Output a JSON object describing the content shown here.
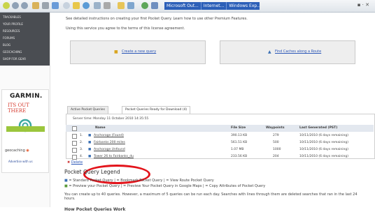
{
  "browser": {
    "taskbar_items": [
      "Microsoft Out...",
      "Internet...",
      "Windows Exp..."
    ],
    "window_controls": "▪ · ✕"
  },
  "sidebar": {
    "nav_items": [
      "TRACKABLES",
      "YOUR PROFILE",
      "RESOURCES",
      "FORUMS",
      "BLOG",
      "GEOCACHING",
      "SHOP FOR GEAR"
    ],
    "ad": {
      "logo": "GARMIN.",
      "tagline": "ITS OUT THERE",
      "geocaching": "geocaching",
      "link": "Advertise with us"
    }
  },
  "main": {
    "top_line": "See detailed instructions on creating your first Pocket Query. Learn how to use other Premium Features.",
    "license_line": "Using this service you agree to the terms of this license agreement.",
    "create_query": "Create a new query",
    "find_caches": "Find Caches along a Route",
    "tabs": {
      "active": "Active Pocket Queries",
      "ready": "Pocket Queries Ready for Download (4)"
    },
    "server_time": "Server time: Monday 11 October 2010 14:35:55",
    "columns": [
      "Name",
      "File Size",
      "Waypoints",
      "Last Generated (PST)"
    ],
    "rows": [
      {
        "num": "1.",
        "name": "Anchorage (Found)",
        "size": "390.13 KB",
        "waypoints": "279",
        "generated": "10/11/2010 (6 days remaining)"
      },
      {
        "num": "2.",
        "name": "Fairbanks 200 miles",
        "size": "561.51 KB",
        "waypoints": "500",
        "generated": "10/11/2010 (6 days remaining)"
      },
      {
        "num": "3.",
        "name": "Anchorage Unfound",
        "size": "1.07 MB",
        "waypoints": "1000",
        "generated": "10/11/2010 (6 days remaining)"
      },
      {
        "num": "4.",
        "name": "Tower 26 to Fairbanks_du",
        "size": "233.56 KB",
        "waypoints": "204",
        "generated": "10/11/2010 (6 days remaining)"
      }
    ],
    "delete_label": "Delete",
    "legend_title": "Pocket Query Legend",
    "legend_line1": "= Standard Pocket Query |  = Bookmark Pocket Query |  = View Route Pocket Query",
    "legend_line2": "= Preview your Pocket Query |  = Preview Your Pocket Query in Google Maps |  = Copy Attributes of Pocket Query",
    "note": "You can create up to 40 queries. However, a maximum of 5 queries can be run each day. Searches with lines through them are deleted searches that ran in the last 24 hours.",
    "how_title": "How Pocket Queries Work"
  },
  "colors": {
    "nav_bg": "#4a4d52",
    "link": "#2d58b8",
    "highlight": "#e3141b",
    "taskbar": "#2c5fb8"
  }
}
